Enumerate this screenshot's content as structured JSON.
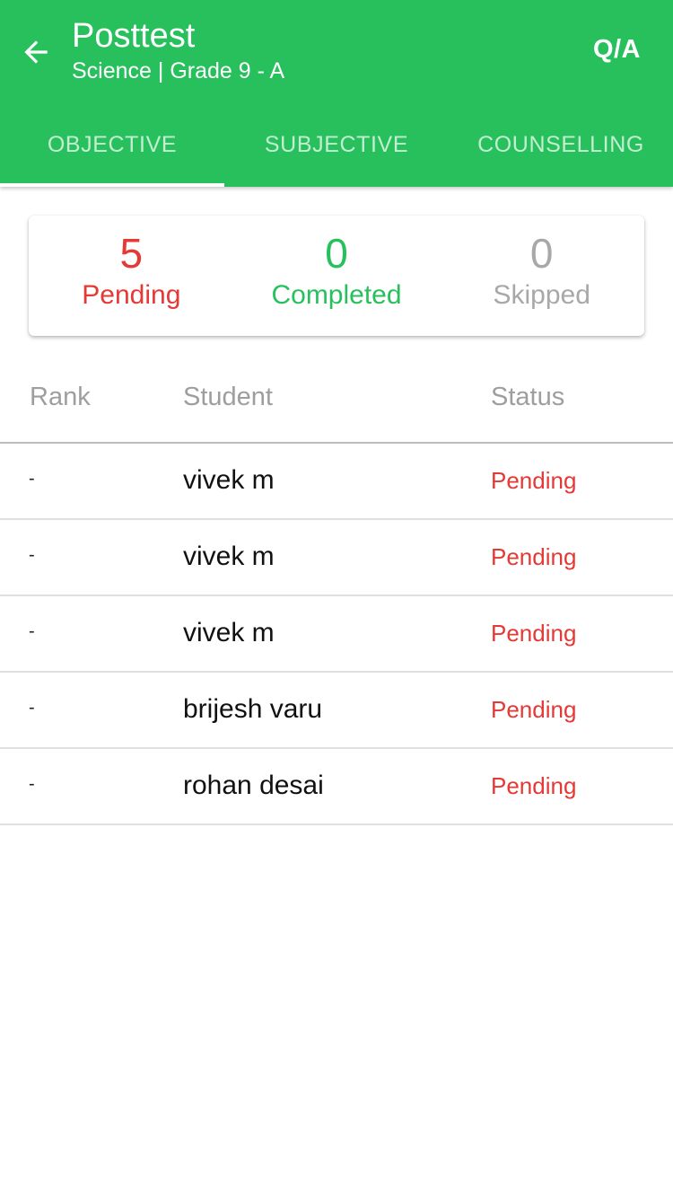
{
  "header": {
    "title": "Posttest",
    "subtitle": "Science | Grade 9 - A",
    "qa_label": "Q/A",
    "back_icon": "arrow-left-icon"
  },
  "tabs": [
    {
      "label": "OBJECTIVE",
      "active": true
    },
    {
      "label": "SUBJECTIVE",
      "active": false
    },
    {
      "label": "COUNSELLING",
      "active": false
    }
  ],
  "summary": {
    "pending": {
      "value": "5",
      "label": "Pending"
    },
    "completed": {
      "value": "0",
      "label": "Completed"
    },
    "skipped": {
      "value": "0",
      "label": "Skipped"
    }
  },
  "table": {
    "columns": [
      "Rank",
      "Student",
      "Status"
    ],
    "rows": [
      {
        "rank": "-",
        "student": "vivek m",
        "status": "Pending"
      },
      {
        "rank": "-",
        "student": "vivek m",
        "status": "Pending"
      },
      {
        "rank": "-",
        "student": "vivek m",
        "status": "Pending"
      },
      {
        "rank": "-",
        "student": "brijesh varu",
        "status": "Pending"
      },
      {
        "rank": "-",
        "student": "rohan desai",
        "status": "Pending"
      }
    ]
  },
  "colors": {
    "primary": "#27c05d",
    "pending": "#e53935",
    "skipped": "#a8a8a8"
  }
}
